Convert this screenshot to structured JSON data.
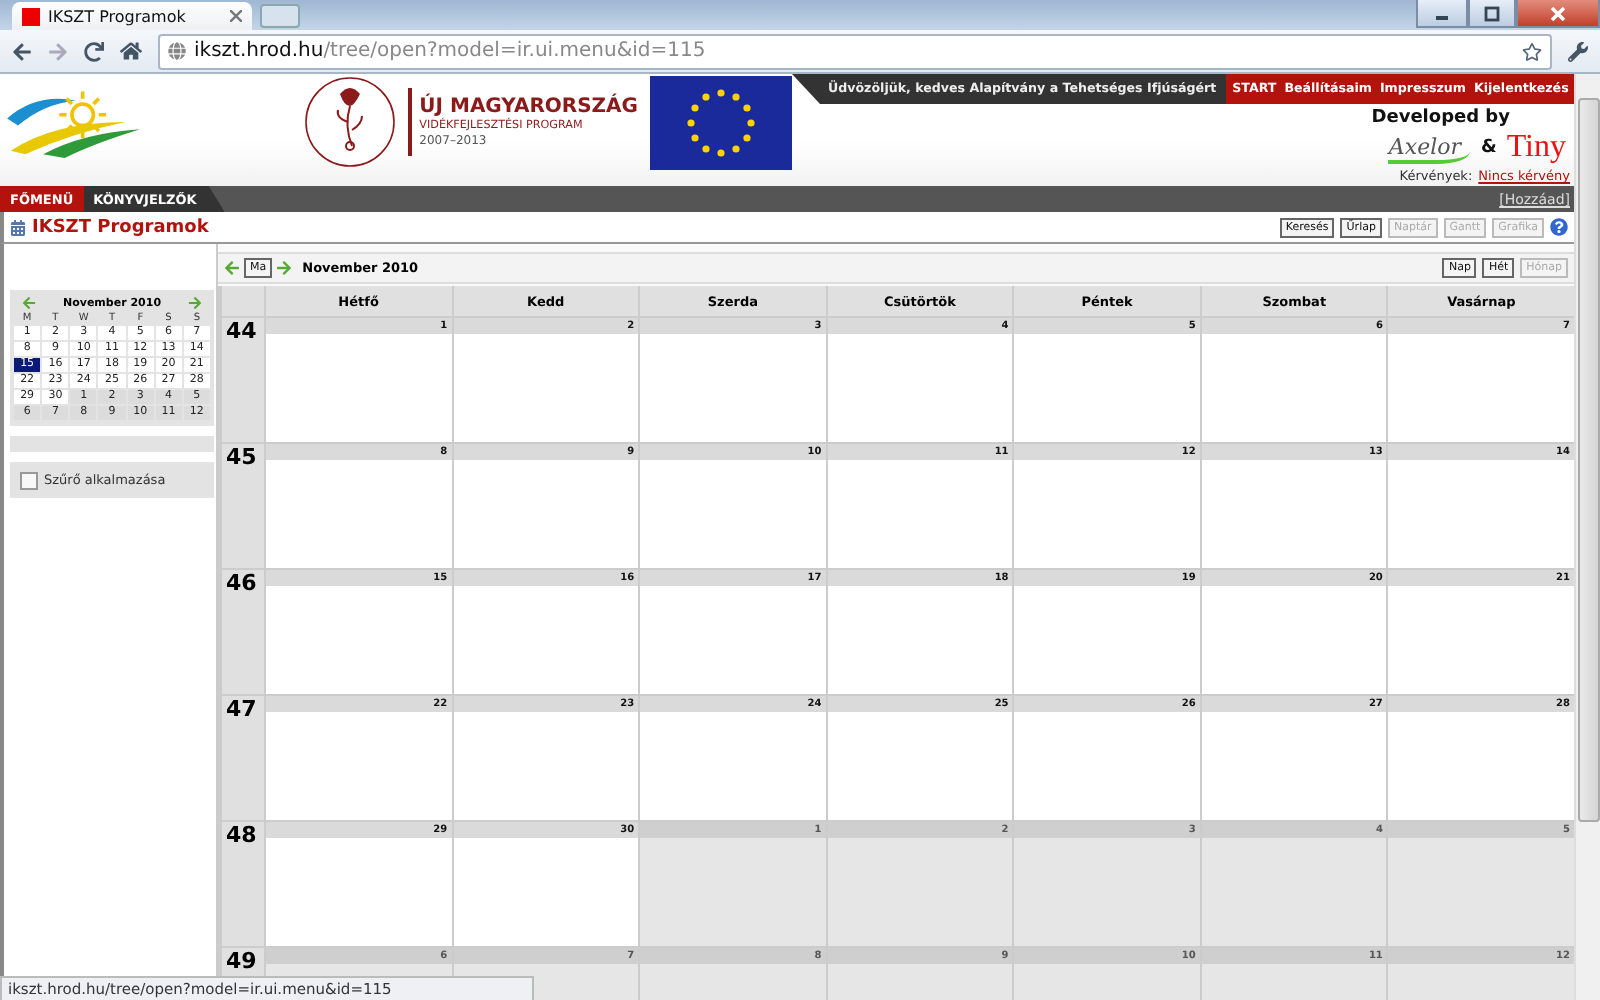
{
  "browser": {
    "tab_title": "IKSZT Programok",
    "url_host": "ikszt.hrod.hu",
    "url_path": "/tree/open?model=ir.ui.menu&id=115"
  },
  "header": {
    "program_title": "ÚJ MAGYARORSZÁG",
    "program_subtitle": "VIDÉKFEJLESZTÉSI PROGRAM",
    "program_years": "2007–2013",
    "welcome": "Üdvözöljük, kedves Alapítvány a Tehetséges Ifjúságért",
    "links": [
      "START",
      "Beállításaim",
      "Impresszum",
      "Kijelentkezés"
    ],
    "developed_by": "Developed by",
    "partner_1": "Axelor",
    "ampersand": "&",
    "partner_2": "Tiny",
    "requests_label": "Kérvények:",
    "requests_value": "Nincs kérvény"
  },
  "menu": {
    "tabs": [
      {
        "label": "FŐMENÜ",
        "selected": true
      },
      {
        "label": "KÖNYVJELZŐK",
        "selected": false
      }
    ],
    "add": "[Hozzáad]"
  },
  "page": {
    "title": "IKSZT Programok",
    "view_buttons": [
      {
        "label": "Keresés",
        "disabled": false
      },
      {
        "label": "Űrlap",
        "disabled": false
      },
      {
        "label": "Naptár",
        "disabled": true
      },
      {
        "label": "Gantt",
        "disabled": true
      },
      {
        "label": "Grafika",
        "disabled": true
      }
    ]
  },
  "sidebar": {
    "mini_calendar": {
      "title": "November 2010",
      "weekdays": [
        "M",
        "T",
        "W",
        "T",
        "F",
        "S",
        "S"
      ],
      "weeks": [
        [
          {
            "day": "1",
            "other_month": false,
            "selected": false
          },
          {
            "day": "2",
            "other_month": false,
            "selected": false
          },
          {
            "day": "3",
            "other_month": false,
            "selected": false
          },
          {
            "day": "4",
            "other_month": false,
            "selected": false
          },
          {
            "day": "5",
            "other_month": false,
            "selected": false
          },
          {
            "day": "6",
            "other_month": false,
            "selected": false
          },
          {
            "day": "7",
            "other_month": false,
            "selected": false
          }
        ],
        [
          {
            "day": "8",
            "other_month": false,
            "selected": false
          },
          {
            "day": "9",
            "other_month": false,
            "selected": false
          },
          {
            "day": "10",
            "other_month": false,
            "selected": false
          },
          {
            "day": "11",
            "other_month": false,
            "selected": false
          },
          {
            "day": "12",
            "other_month": false,
            "selected": false
          },
          {
            "day": "13",
            "other_month": false,
            "selected": false
          },
          {
            "day": "14",
            "other_month": false,
            "selected": false
          }
        ],
        [
          {
            "day": "15",
            "other_month": false,
            "selected": true
          },
          {
            "day": "16",
            "other_month": false,
            "selected": false
          },
          {
            "day": "17",
            "other_month": false,
            "selected": false
          },
          {
            "day": "18",
            "other_month": false,
            "selected": false
          },
          {
            "day": "19",
            "other_month": false,
            "selected": false
          },
          {
            "day": "20",
            "other_month": false,
            "selected": false
          },
          {
            "day": "21",
            "other_month": false,
            "selected": false
          }
        ],
        [
          {
            "day": "22",
            "other_month": false,
            "selected": false
          },
          {
            "day": "23",
            "other_month": false,
            "selected": false
          },
          {
            "day": "24",
            "other_month": false,
            "selected": false
          },
          {
            "day": "25",
            "other_month": false,
            "selected": false
          },
          {
            "day": "26",
            "other_month": false,
            "selected": false
          },
          {
            "day": "27",
            "other_month": false,
            "selected": false
          },
          {
            "day": "28",
            "other_month": false,
            "selected": false
          }
        ],
        [
          {
            "day": "29",
            "other_month": false,
            "selected": false
          },
          {
            "day": "30",
            "other_month": false,
            "selected": false
          },
          {
            "day": "1",
            "other_month": true,
            "selected": false
          },
          {
            "day": "2",
            "other_month": true,
            "selected": false
          },
          {
            "day": "3",
            "other_month": true,
            "selected": false
          },
          {
            "day": "4",
            "other_month": true,
            "selected": false
          },
          {
            "day": "5",
            "other_month": true,
            "selected": false
          }
        ],
        [
          {
            "day": "6",
            "other_month": true,
            "selected": false
          },
          {
            "day": "7",
            "other_month": true,
            "selected": false
          },
          {
            "day": "8",
            "other_month": true,
            "selected": false
          },
          {
            "day": "9",
            "other_month": true,
            "selected": false
          },
          {
            "day": "10",
            "other_month": true,
            "selected": false
          },
          {
            "day": "11",
            "other_month": true,
            "selected": false
          },
          {
            "day": "12",
            "other_month": true,
            "selected": false
          }
        ]
      ]
    },
    "filter": {
      "label": "Szűrő alkalmazása",
      "checked": false
    }
  },
  "calendar": {
    "today": "Ma",
    "title": "November 2010",
    "modes": [
      {
        "label": "Nap",
        "disabled": false
      },
      {
        "label": "Hét",
        "disabled": false
      },
      {
        "label": "Hónap",
        "disabled": true
      }
    ],
    "weekdays": [
      "Hétfő",
      "Kedd",
      "Szerda",
      "Csütörtök",
      "Péntek",
      "Szombat",
      "Vasárnap"
    ],
    "weeks": [
      {
        "number": "44",
        "days": [
          {
            "day": "1",
            "other_month": false
          },
          {
            "day": "2",
            "other_month": false
          },
          {
            "day": "3",
            "other_month": false
          },
          {
            "day": "4",
            "other_month": false
          },
          {
            "day": "5",
            "other_month": false
          },
          {
            "day": "6",
            "other_month": false
          },
          {
            "day": "7",
            "other_month": false
          }
        ]
      },
      {
        "number": "45",
        "days": [
          {
            "day": "8",
            "other_month": false
          },
          {
            "day": "9",
            "other_month": false
          },
          {
            "day": "10",
            "other_month": false
          },
          {
            "day": "11",
            "other_month": false
          },
          {
            "day": "12",
            "other_month": false
          },
          {
            "day": "13",
            "other_month": false
          },
          {
            "day": "14",
            "other_month": false
          }
        ]
      },
      {
        "number": "46",
        "days": [
          {
            "day": "15",
            "other_month": false
          },
          {
            "day": "16",
            "other_month": false
          },
          {
            "day": "17",
            "other_month": false
          },
          {
            "day": "18",
            "other_month": false
          },
          {
            "day": "19",
            "other_month": false
          },
          {
            "day": "20",
            "other_month": false
          },
          {
            "day": "21",
            "other_month": false
          }
        ]
      },
      {
        "number": "47",
        "days": [
          {
            "day": "22",
            "other_month": false
          },
          {
            "day": "23",
            "other_month": false
          },
          {
            "day": "24",
            "other_month": false
          },
          {
            "day": "25",
            "other_month": false
          },
          {
            "day": "26",
            "other_month": false
          },
          {
            "day": "27",
            "other_month": false
          },
          {
            "day": "28",
            "other_month": false
          }
        ]
      },
      {
        "number": "48",
        "days": [
          {
            "day": "29",
            "other_month": false
          },
          {
            "day": "30",
            "other_month": false
          },
          {
            "day": "1",
            "other_month": true
          },
          {
            "day": "2",
            "other_month": true
          },
          {
            "day": "3",
            "other_month": true
          },
          {
            "day": "4",
            "other_month": true
          },
          {
            "day": "5",
            "other_month": true
          }
        ]
      },
      {
        "number": "49",
        "days": [
          {
            "day": "6",
            "other_month": true
          },
          {
            "day": "7",
            "other_month": true
          },
          {
            "day": "8",
            "other_month": true
          },
          {
            "day": "9",
            "other_month": true
          },
          {
            "day": "10",
            "other_month": true
          },
          {
            "day": "11",
            "other_month": true
          },
          {
            "day": "12",
            "other_month": true
          }
        ]
      }
    ]
  },
  "status_url": "ikszt.hrod.hu/tree/open?model=ir.ui.menu&id=115"
}
